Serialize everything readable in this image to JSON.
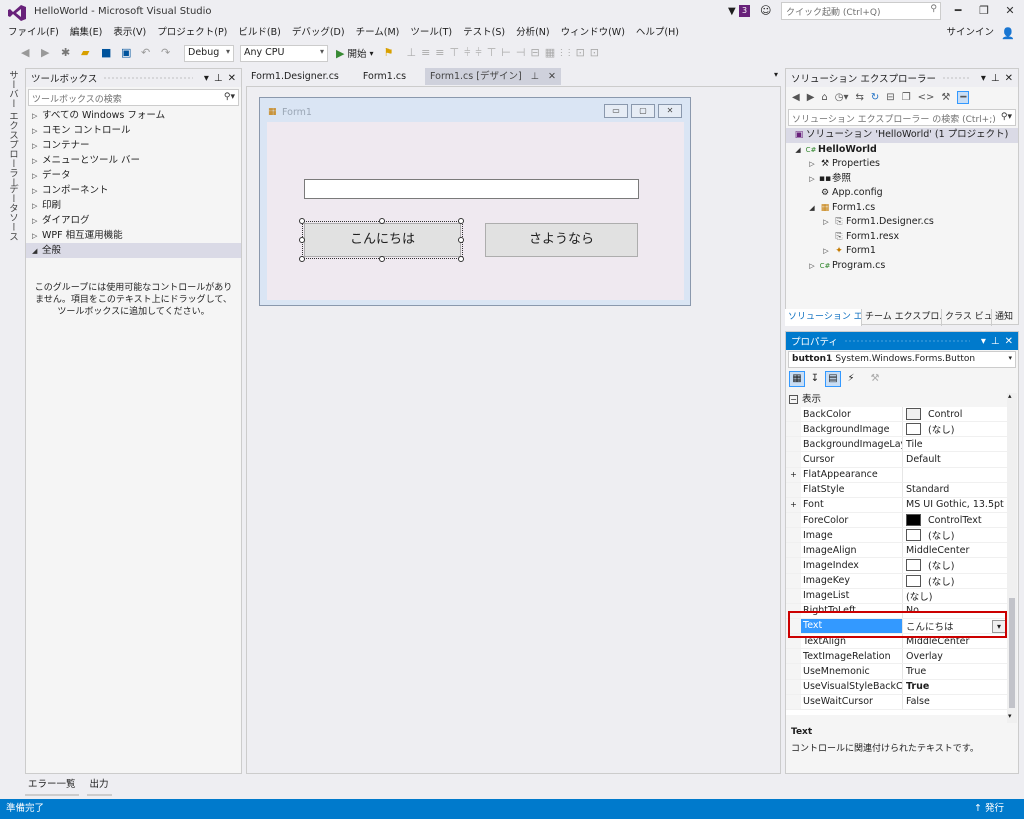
{
  "window": {
    "title": "HelloWorld - Microsoft Visual Studio",
    "notification_count": "3",
    "quick_launch_placeholder": "クイック起動 (Ctrl+Q)",
    "signin": "サインイン"
  },
  "menu": [
    "ファイル(F)",
    "編集(E)",
    "表示(V)",
    "プロジェクト(P)",
    "ビルド(B)",
    "デバッグ(D)",
    "チーム(M)",
    "ツール(T)",
    "テスト(S)",
    "分析(N)",
    "ウィンドウ(W)",
    "ヘルプ(H)"
  ],
  "toolbar": {
    "config": "Debug",
    "platform": "Any CPU",
    "start": "開始"
  },
  "left_strip": [
    "サーバー エクスプローラー",
    "データソース"
  ],
  "toolbox": {
    "title": "ツールボックス",
    "search_placeholder": "ツールボックスの検索",
    "groups": [
      "すべての Windows フォーム",
      "コモン コントロール",
      "コンテナー",
      "メニューとツール バー",
      "データ",
      "コンポーネント",
      "印刷",
      "ダイアログ",
      "WPF 相互運用機能",
      "全般"
    ],
    "empty_message": "このグループには使用可能なコントロールがありません。項目をこのテキスト上にドラッグして、ツールボックスに追加してください。"
  },
  "doc_tabs": [
    "Form1.Designer.cs",
    "Form1.cs",
    "Form1.cs [デザイン]"
  ],
  "form": {
    "title": "Form1",
    "button1": "こんにちは",
    "button2": "さようなら"
  },
  "solution_explorer": {
    "title": "ソリューション エクスプローラー",
    "search_placeholder": "ソリューション エクスプローラー の検索 (Ctrl+;)",
    "nodes": [
      {
        "label": "ソリューション 'HelloWorld' (1 プロジェクト)",
        "icon": "solution-icon"
      },
      {
        "label": "HelloWorld",
        "icon": "csharp-project-icon"
      },
      {
        "label": "Properties",
        "icon": "wrench-icon"
      },
      {
        "label": "参照",
        "icon": "references-icon"
      },
      {
        "label": "App.config",
        "icon": "config-icon"
      },
      {
        "label": "Form1.cs",
        "icon": "form-icon"
      },
      {
        "label": "Form1.Designer.cs",
        "icon": "cs-file-icon"
      },
      {
        "label": "Form1.resx",
        "icon": "resx-icon"
      },
      {
        "label": "Form1",
        "icon": "class-icon"
      },
      {
        "label": "Program.cs",
        "icon": "csharp-file-icon"
      }
    ],
    "bottom_tabs": [
      "ソリューション エ...",
      "チーム エクスプロ...",
      "クラス ビュー",
      "通知"
    ]
  },
  "properties": {
    "title": "プロパティ",
    "object_name": "button1",
    "object_type": "System.Windows.Forms.Button",
    "category": "表示",
    "rows": [
      {
        "name": "BackColor",
        "value": "Control",
        "swatch": "#f0f0f0"
      },
      {
        "name": "BackgroundImage",
        "value": "(なし)",
        "swatch": "#ffffff"
      },
      {
        "name": "BackgroundImageLayout",
        "value": "Tile"
      },
      {
        "name": "Cursor",
        "value": "Default"
      },
      {
        "name": "FlatAppearance",
        "value": "",
        "expand": "+"
      },
      {
        "name": "FlatStyle",
        "value": "Standard"
      },
      {
        "name": "Font",
        "value": "MS UI Gothic, 13.5pt",
        "expand": "+"
      },
      {
        "name": "ForeColor",
        "value": "ControlText",
        "swatch": "#000000"
      },
      {
        "name": "Image",
        "value": "(なし)",
        "swatch": "#ffffff"
      },
      {
        "name": "ImageAlign",
        "value": "MiddleCenter"
      },
      {
        "name": "ImageIndex",
        "value": "(なし)",
        "swatch": "#ffffff"
      },
      {
        "name": "ImageKey",
        "value": "(なし)",
        "swatch": "#ffffff"
      },
      {
        "name": "ImageList",
        "value": "(なし)"
      },
      {
        "name": "RightToLeft",
        "value": "No"
      },
      {
        "name": "Text",
        "value": "こんにちは",
        "selected": true
      },
      {
        "name": "TextAlign",
        "value": "MiddleCenter"
      },
      {
        "name": "TextImageRelation",
        "value": "Overlay"
      },
      {
        "name": "UseMnemonic",
        "value": "True"
      },
      {
        "name": "UseVisualStyleBackColor",
        "value": "True",
        "bold": true
      },
      {
        "name": "UseWaitCursor",
        "value": "False"
      }
    ],
    "description_title": "Text",
    "description": "コントロールに関連付けられたテキストです。"
  },
  "bottom_tabs": [
    "エラー一覧",
    "出力"
  ],
  "status": {
    "text": "準備完了",
    "publish": "発行"
  },
  "colors": {
    "accent": "#007acc",
    "highlight_border": "#cc0000",
    "vs_logo": "#68217a"
  }
}
